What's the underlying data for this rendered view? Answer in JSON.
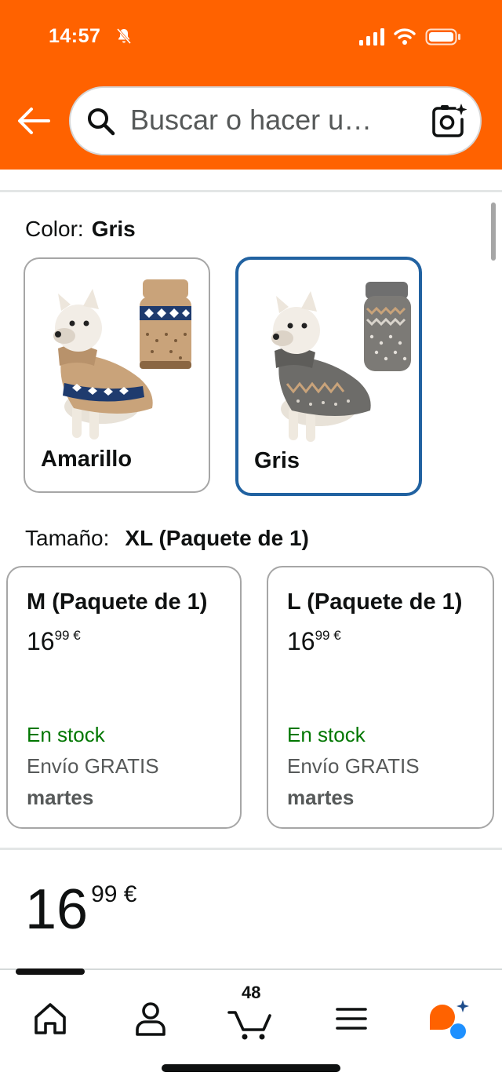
{
  "status_bar": {
    "time": "14:57"
  },
  "header": {
    "search_placeholder": "Buscar o hacer u…"
  },
  "color_selector": {
    "label": "Color:",
    "selected": "Gris",
    "options": [
      {
        "name": "Amarillo",
        "selected": false
      },
      {
        "name": "Gris",
        "selected": true
      }
    ]
  },
  "size_selector": {
    "label": "Tamaño:",
    "selected": "XL (Paquete de 1)",
    "options": [
      {
        "title": "M (Paquete de 1)",
        "price_main": "16",
        "price_frac": "99 €",
        "stock": "En stock",
        "shipping": "Envío GRATIS",
        "delivery_day": "martes"
      },
      {
        "title": "L (Paquete de 1)",
        "price_main": "16",
        "price_frac": "99 €",
        "stock": "En stock",
        "shipping": "Envío GRATIS",
        "delivery_day": "martes"
      }
    ]
  },
  "price": {
    "main": "16",
    "frac": "99 €"
  },
  "bottom_nav": {
    "items": [
      "home-icon",
      "account-icon",
      "cart-icon",
      "menu-icon",
      "rufus-icon"
    ],
    "cart_count": "48"
  },
  "colors": {
    "brand_orange": "#ff6200",
    "selected_border": "#2162a1",
    "in_stock_green": "#007600"
  }
}
